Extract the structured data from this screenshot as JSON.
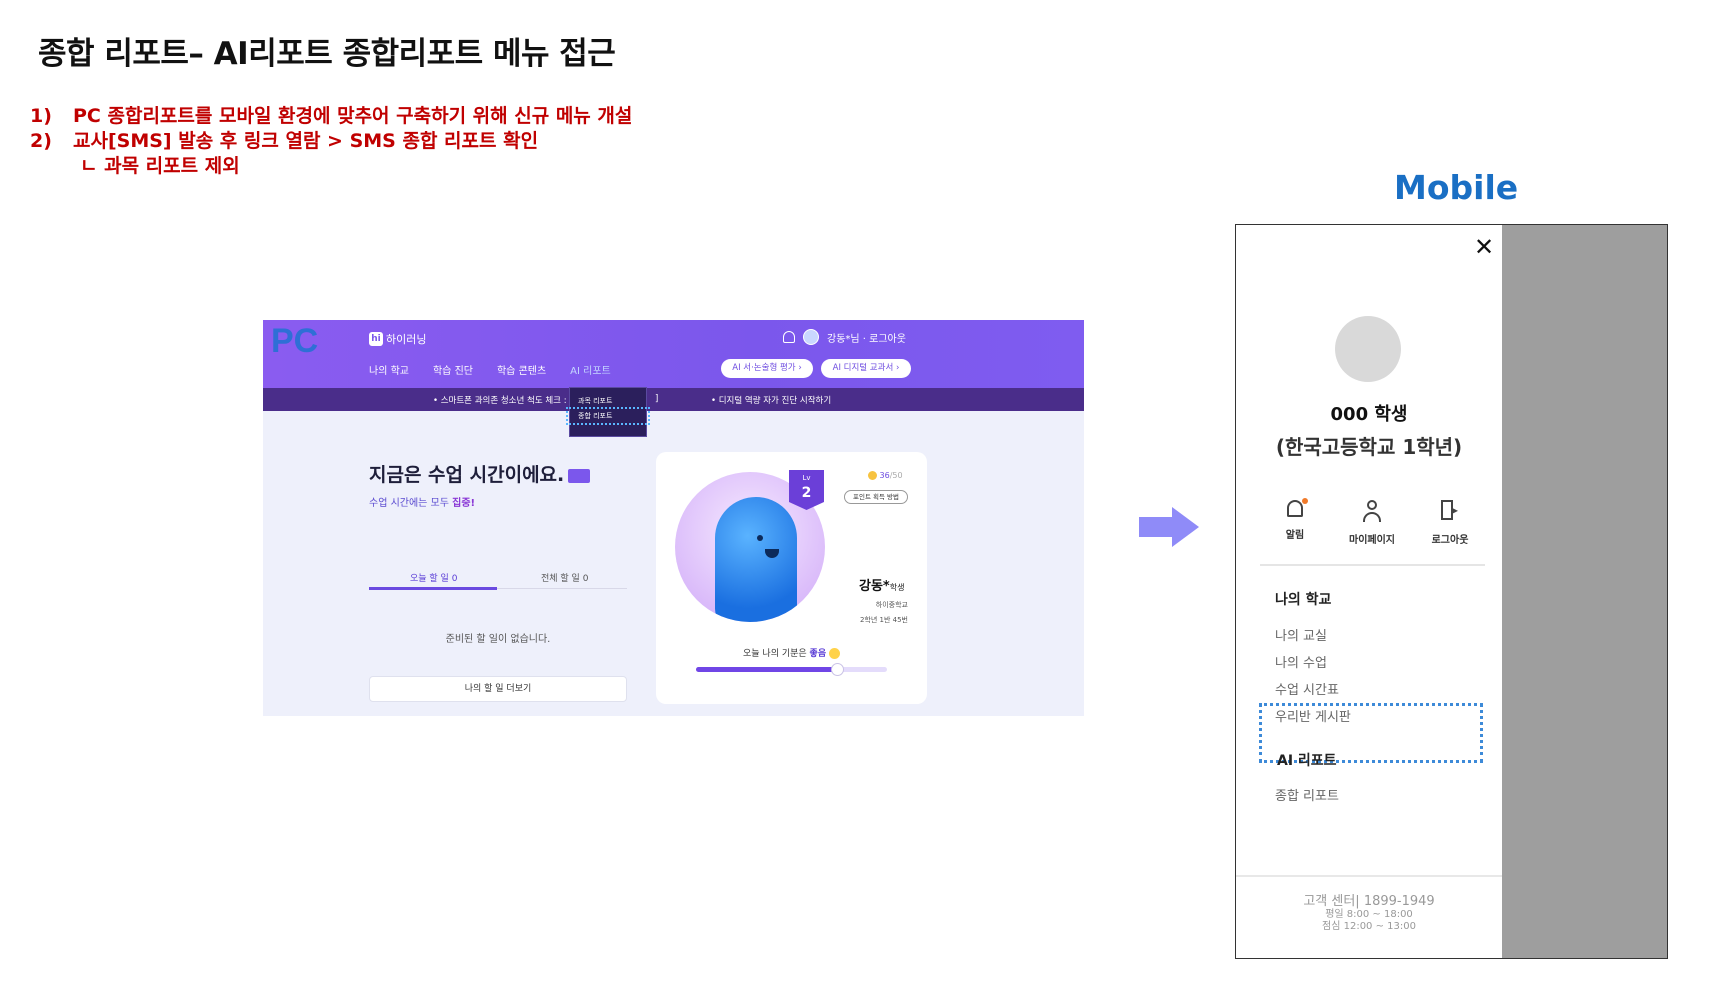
{
  "slide": {
    "title": "종합 리포트– AI리포트 종합리포트 메뉴 접근",
    "notes": [
      {
        "num": "1)",
        "text": "PC 종합리포트를 모바일 환경에 맞추어 구축하기 위해 신규 메뉴 개설"
      },
      {
        "num": "2)",
        "text": "교사[SMS] 발송 후 링크 열람 > SMS 종합 리포트 확인"
      }
    ],
    "subnote": "ㄴ 과목 리포트 제외",
    "mobile_heading": "Mobile"
  },
  "pc": {
    "tag": "PC",
    "logo": "하이러닝",
    "user_text": "강동*님 · 로그아웃",
    "nav": [
      "나의 학교",
      "학습 진단",
      "학습 콘텐츠",
      "AI 리포트"
    ],
    "pill1": "AI 서·논술형 평가  ›",
    "pill2": "AI 디지털 교과서  ›",
    "banner_left": "• 스마트폰 과의존 청소년 척도 체크 :",
    "banner_left_end": "]",
    "banner_right": "• 디지털 역량 자가 진단 시작하기",
    "dropdown": [
      "과목 리포트",
      "종합 리포트"
    ],
    "hello": "지금은 수업 시간이에요.",
    "sub_text": "수업 시간에는 모두 ",
    "sub_emph": "집중!",
    "tab1": "오늘 할 일 0",
    "tab2": "전체 할 일 0",
    "empty": "준비된 할 일이 없습니다.",
    "more_button": "나의 할 일 더보기",
    "level_label": "Lv",
    "level": "2",
    "points": "36",
    "points_max": "/50",
    "points_button": "포인트 획득 방법",
    "student_name": "강동*",
    "student_suffix": "학생",
    "school": "하이중학교",
    "class": "2학년 1반 45번",
    "mood_text": "오늘 나의 기분은 ",
    "mood_value": "좋음",
    "mood_level": 0.74
  },
  "mobile": {
    "close": "✕",
    "name": "000 학생",
    "school": "(한국고등학교 1학년)",
    "actions": [
      "알림",
      "마이페이지",
      "로그아웃"
    ],
    "section1": "나의 학교",
    "items": [
      "나의 교실",
      "나의 수업",
      "수업 시간표",
      "우리반 게시판"
    ],
    "section2": "AI 리포트",
    "report_item": "종합 리포트",
    "footer1": "고객 센터| 1899-1949",
    "footer2": "평일 8:00 ~ 18:00",
    "footer3": "점심 12:00 ~ 13:00"
  },
  "colors": {
    "accent": "#7b57ec",
    "note_red": "#c00000",
    "mobile_blue": "#1a6fc4",
    "highlight_dots": "#3d8ad8"
  }
}
